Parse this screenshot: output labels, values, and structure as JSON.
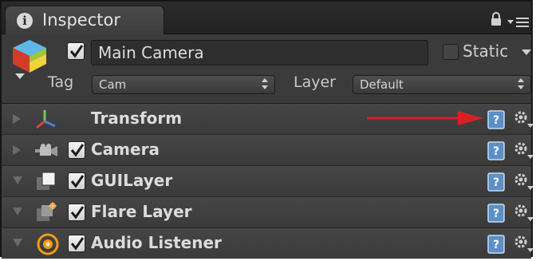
{
  "tab": {
    "title": "Inspector",
    "info_glyph": "i"
  },
  "header": {
    "object_enabled": true,
    "name": "Main Camera",
    "static_label": "Static",
    "static_checked": false,
    "tag_label": "Tag",
    "tag_value": "Cam",
    "layer_label": "Layer",
    "layer_value": "Default"
  },
  "components": [
    {
      "label": "Transform",
      "has_checkbox": false,
      "expanded": false,
      "icon": "transform-axes-icon"
    },
    {
      "label": "Camera",
      "has_checkbox": true,
      "checked": true,
      "expanded": false,
      "icon": "camera-icon"
    },
    {
      "label": "GUILayer",
      "has_checkbox": true,
      "checked": true,
      "expanded": true,
      "icon": "gui-layer-icon"
    },
    {
      "label": "Flare Layer",
      "has_checkbox": true,
      "checked": true,
      "expanded": true,
      "icon": "flare-layer-icon"
    },
    {
      "label": "Audio Listener",
      "has_checkbox": true,
      "checked": true,
      "expanded": true,
      "icon": "audio-listener-icon"
    }
  ],
  "colors": {
    "panel_bg": "#3b3b3b",
    "annotation_arrow": "#d92020",
    "help_icon": "#5b8fc7"
  }
}
